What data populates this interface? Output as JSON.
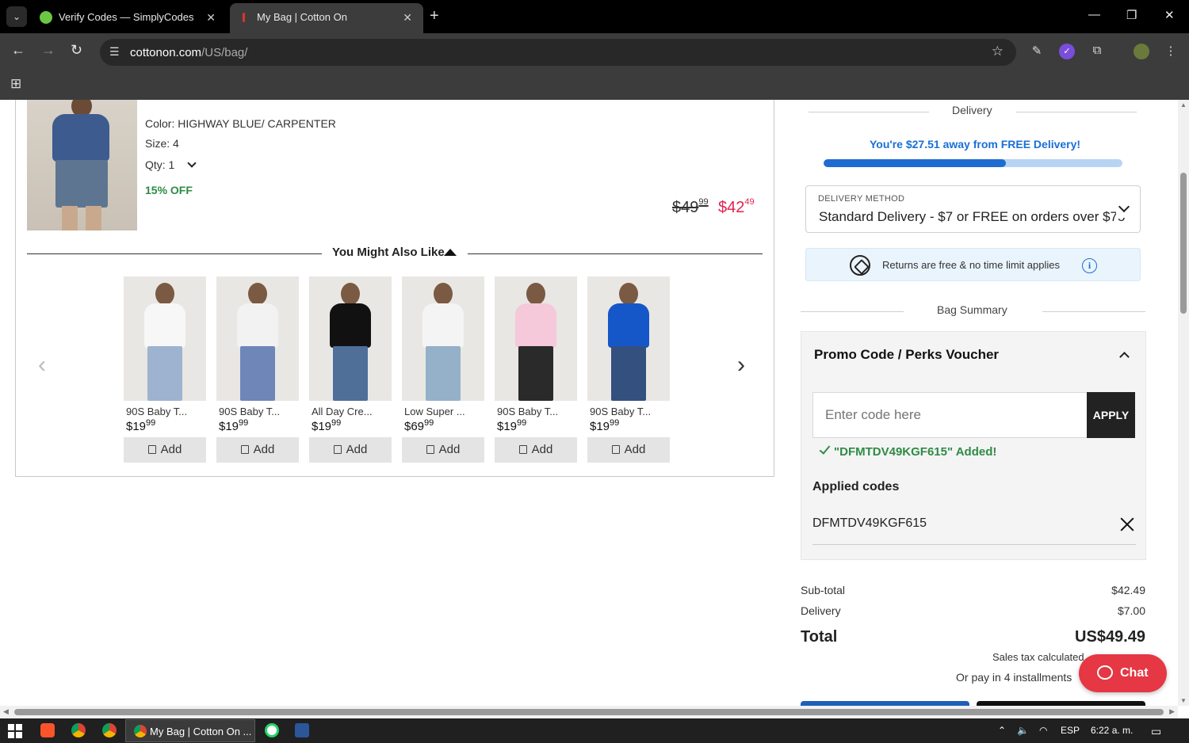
{
  "browser": {
    "tabs": [
      {
        "title": "Verify Codes — SimplyCodes",
        "close": "✕"
      },
      {
        "title": "My Bag | Cotton On",
        "close": "✕"
      }
    ],
    "new_tab": "+",
    "window_controls": {
      "minimize": "—",
      "restore": "❐",
      "close": "✕"
    },
    "url_host": "cottonon.com",
    "url_path": "/US/bag/"
  },
  "product": {
    "color": "Color: HIGHWAY BLUE/ CARPENTER",
    "size": "Size: 4",
    "qty": "Qty: 1",
    "discount": "15% OFF",
    "price_old": "$49",
    "price_old_cents": "99",
    "price_new": "$42",
    "price_new_cents": "49"
  },
  "recommendations": {
    "title": "You Might Also Like",
    "add_label": "Add",
    "items": [
      {
        "name": "90S Baby T...",
        "price": "$19",
        "cents": "99",
        "shirt": "#f7f7f7",
        "pants": "#9db3cf"
      },
      {
        "name": "90S Baby T...",
        "price": "$19",
        "cents": "99",
        "shirt": "#f2f2f2",
        "pants": "#6f86b8"
      },
      {
        "name": "All Day Cre...",
        "price": "$19",
        "cents": "99",
        "shirt": "#111111",
        "pants": "#4f6f99"
      },
      {
        "name": "Low Super ...",
        "price": "$69",
        "cents": "99",
        "shirt": "#f4f4f4",
        "pants": "#95b0c9"
      },
      {
        "name": "90S Baby T...",
        "price": "$19",
        "cents": "99",
        "shirt": "#f5c8da",
        "pants": "#2a2a2a"
      },
      {
        "name": "90S Baby T...",
        "price": "$19",
        "cents": "99",
        "shirt": "#1556c9",
        "pants": "#34507e"
      }
    ]
  },
  "delivery": {
    "title": "Delivery",
    "free_message": "You're $27.51 away from FREE Delivery!",
    "progress_fraction": 0.61,
    "method_label": "DELIVERY METHOD",
    "method_value": "Standard Delivery - $7 or FREE on orders over $75",
    "returns_text": "Returns are free & no time limit applies",
    "info_glyph": "i"
  },
  "bag_summary": {
    "title": "Bag Summary",
    "promo_title": "Promo Code / Perks Voucher",
    "promo_placeholder": "Enter code here",
    "apply_label": "APPLY",
    "success_message": "\"DFMTDV49KGF615\" Added!",
    "applied_title": "Applied codes",
    "applied_code": "DFMTDV49KGF615",
    "subtotal_label": "Sub-total",
    "subtotal_value": "$42.49",
    "delivery_label": "Delivery",
    "delivery_value": "$7.00",
    "total_label": "Total",
    "total_value": "US$49.49",
    "tax_note": "Sales tax calculated",
    "installments": "Or pay in 4 installments"
  },
  "chat": {
    "label": "Chat"
  },
  "taskbar": {
    "active_window": "My Bag | Cotton On ...",
    "language": "ESP",
    "time": "6:22 a. m."
  },
  "colors": {
    "accent_blue": "#1f6cd1",
    "sale_red": "#e0224d",
    "success_green": "#2e8b45",
    "chat_red": "#e53744"
  }
}
